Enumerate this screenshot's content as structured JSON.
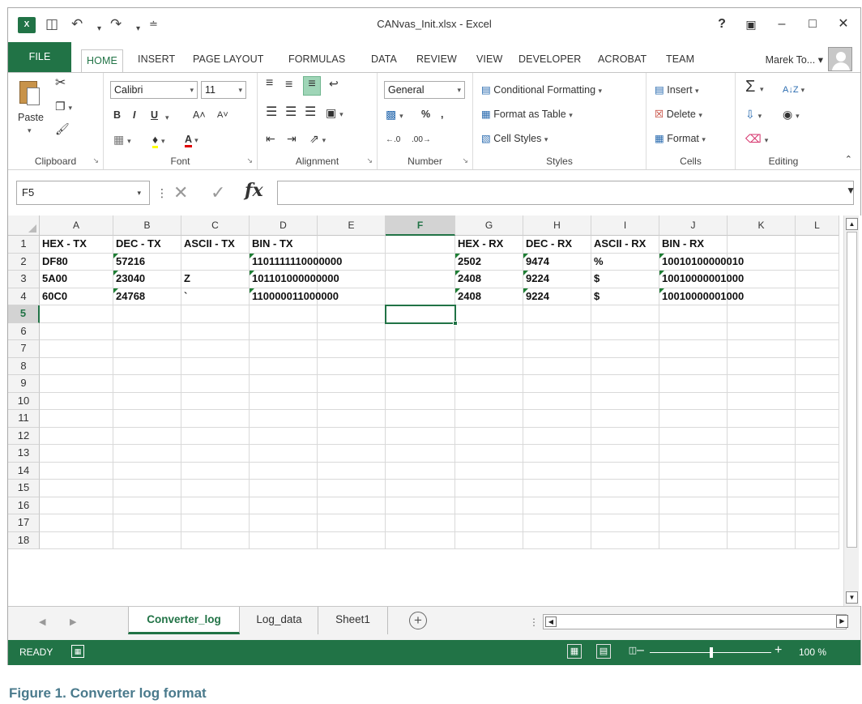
{
  "window": {
    "title": "CANvas_Init.xlsx - Excel",
    "app_icon": "X",
    "help": "?",
    "ribbon_display": "▣",
    "minimize": "–",
    "maximize": "□",
    "close": "✕"
  },
  "qat": {
    "save": "💾",
    "undo": "↶",
    "redo": "↷",
    "customize": "≐"
  },
  "tabs": [
    "FILE",
    "HOME",
    "INSERT",
    "PAGE LAYOUT",
    "FORMULAS",
    "DATA",
    "REVIEW",
    "VIEW",
    "DEVELOPER",
    "ACROBAT",
    "TEAM"
  ],
  "user": {
    "name": "Marek To...",
    "caret": "▾"
  },
  "ribbon": {
    "clipboard": {
      "label": "Clipboard",
      "paste": "Paste"
    },
    "font": {
      "label": "Font",
      "name": "Calibri",
      "size": "11",
      "bold": "B",
      "italic": "I",
      "underline": "U",
      "grow": "A˄",
      "shrink": "A˅",
      "font_color": "A"
    },
    "alignment": {
      "label": "Alignment"
    },
    "number": {
      "label": "Number",
      "format": "General",
      "percent": "%",
      "comma": ",",
      "inc_dec": "←.0",
      "dec_dec": ".00→"
    },
    "styles": {
      "label": "Styles",
      "conditional": "Conditional Formatting",
      "format_table": "Format as Table",
      "cell_styles": "Cell Styles"
    },
    "cells": {
      "label": "Cells",
      "insert": "Insert",
      "delete": "Delete",
      "format": "Format"
    },
    "editing": {
      "label": "Editing",
      "autosum": "Σ",
      "sort": "A↓Z",
      "find": "🔍"
    }
  },
  "formula_bar": {
    "name_box": "F5",
    "fx": "fx",
    "cancel": "✕",
    "enter": "✓",
    "value": ""
  },
  "columns": [
    "A",
    "B",
    "C",
    "D",
    "E",
    "F",
    "G",
    "H",
    "I",
    "J",
    "K",
    "L"
  ],
  "selected_column": "F",
  "rows": [
    [
      "HEX - TX",
      "DEC - TX",
      "ASCII - TX",
      "BIN - TX",
      "",
      "",
      "HEX - RX",
      "DEC - RX",
      "ASCII - RX",
      "BIN - RX",
      "",
      ""
    ],
    [
      "DF80",
      "57216",
      "",
      "1101111110000000",
      "",
      "",
      "2502",
      "9474",
      "%",
      "10010100000010",
      "",
      ""
    ],
    [
      "5A00",
      "23040",
      "Z",
      "101101000000000",
      "",
      "",
      "2408",
      "9224",
      "$",
      "10010000001000",
      "",
      ""
    ],
    [
      "60C0",
      "24768",
      "`",
      "110000011000000",
      "",
      "",
      "2408",
      "9224",
      "$",
      "10010000001000",
      "",
      ""
    ]
  ],
  "row_numbers": [
    "1",
    "2",
    "3",
    "4",
    "5",
    "6",
    "7",
    "8",
    "9",
    "10",
    "11",
    "12",
    "13",
    "14",
    "15",
    "16",
    "17",
    "18"
  ],
  "selected_row": "5",
  "sheets": [
    {
      "name": "Converter_log",
      "active": true
    },
    {
      "name": "Log_data",
      "active": false
    },
    {
      "name": "Sheet1",
      "active": false
    }
  ],
  "status": {
    "text": "READY",
    "zoom": "100 %"
  },
  "caption": "Figure 1. Converter log format"
}
